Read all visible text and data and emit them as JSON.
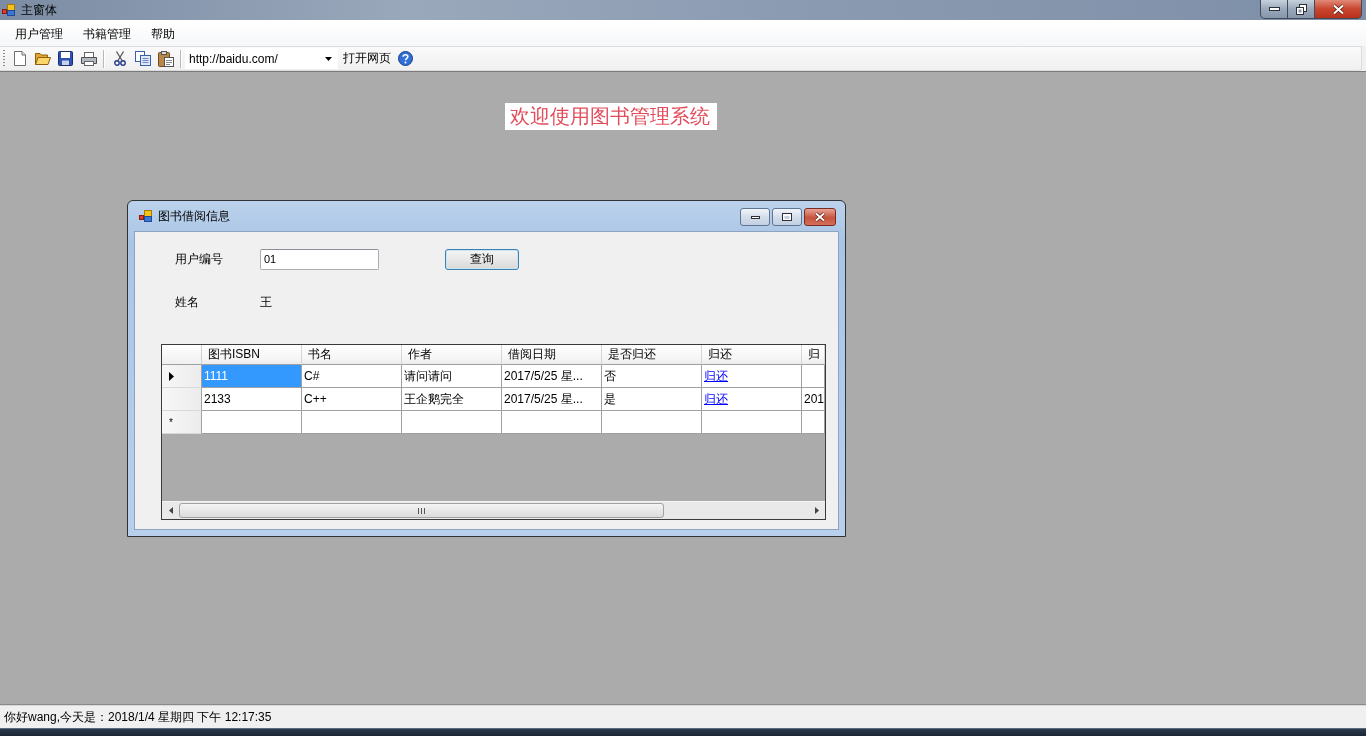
{
  "window": {
    "title": "主窗体"
  },
  "menu": [
    {
      "label": "用户管理"
    },
    {
      "label": "书籍管理"
    },
    {
      "label": "帮助"
    }
  ],
  "toolbar": {
    "url": {
      "value": "http://baidu.com/"
    },
    "open_page_button": "打开网页"
  },
  "welcome": "欢迎使用图书管理系统",
  "borrow_window": {
    "title": "图书借阅信息",
    "user_id": {
      "label": "用户编号",
      "value": "01"
    },
    "query_button": "查询",
    "name": {
      "label": "姓名",
      "value": "王"
    },
    "grid": {
      "columns": [
        {
          "label": "图书ISBN",
          "kind": "text"
        },
        {
          "label": "书名",
          "kind": "text"
        },
        {
          "label": "作者",
          "kind": "text"
        },
        {
          "label": "借阅日期",
          "kind": "text"
        },
        {
          "label": "是否归还",
          "kind": "text"
        },
        {
          "label": "归还",
          "kind": "link"
        },
        {
          "label": "归",
          "kind": "text"
        }
      ],
      "rows": [
        {
          "kind": "data",
          "current": true,
          "cells": [
            {
              "text": "1111",
              "selected": true
            },
            {
              "text": "C#",
              "selected": false
            },
            {
              "text": "请问请问",
              "selected": false
            },
            {
              "text": "2017/5/25 星...",
              "selected": false
            },
            {
              "text": "否",
              "selected": false
            },
            {
              "text": "归还",
              "selected": false
            },
            {
              "selected": false
            }
          ]
        },
        {
          "kind": "data",
          "current": false,
          "cells": [
            {
              "text": "2133",
              "selected": false
            },
            {
              "text": "C++",
              "selected": false
            },
            {
              "text": "王企鹅完全",
              "selected": false
            },
            {
              "text": "2017/5/25 星...",
              "selected": false
            },
            {
              "text": "是",
              "selected": false
            },
            {
              "text": "归还",
              "selected": false
            },
            {
              "text": "201",
              "selected": false
            }
          ]
        },
        {
          "kind": "new",
          "current": false,
          "marker": "*"
        }
      ]
    }
  },
  "status_bar": "你好wang,今天是：2018/1/4 星期四 下午 12:17:35"
}
